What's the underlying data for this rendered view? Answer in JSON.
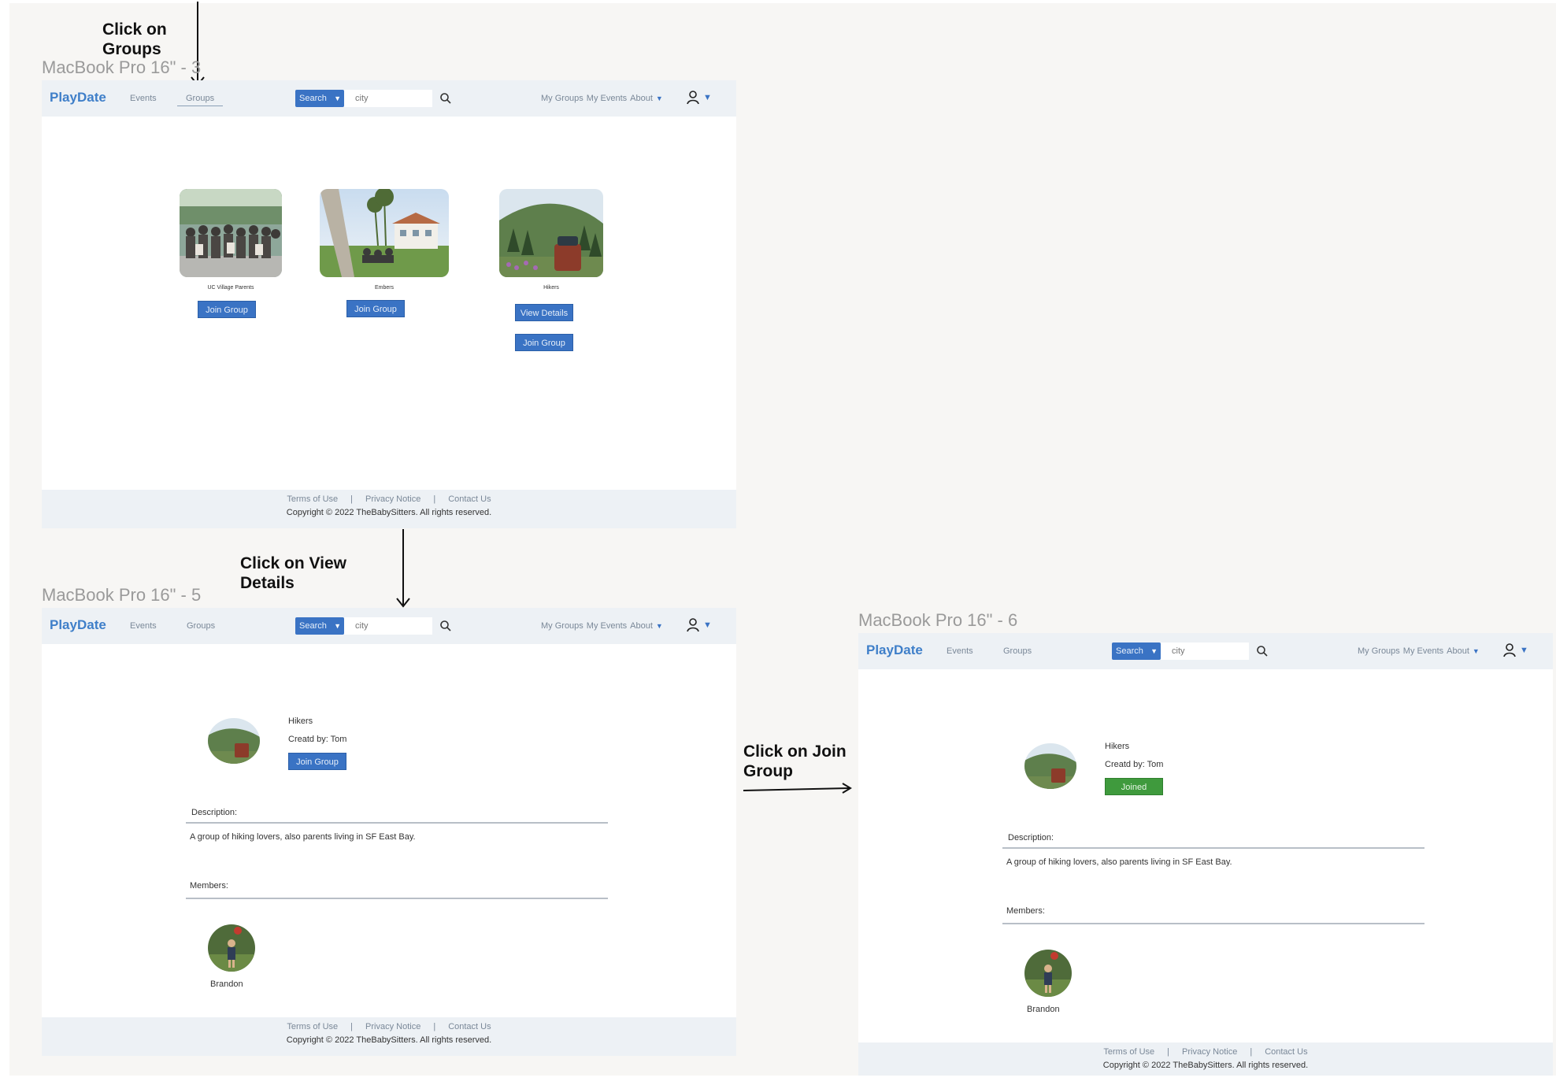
{
  "annotations": {
    "click_groups": [
      "Click on",
      "Groups"
    ],
    "click_view_details": [
      "Click on  View",
      "Details"
    ],
    "click_join_group": [
      "Click on Join",
      "Group"
    ]
  },
  "frames": {
    "f3": {
      "label": "MacBook Pro 16\" - 3"
    },
    "f5": {
      "label": "MacBook Pro 16\" - 5"
    },
    "f6": {
      "label": "MacBook Pro 16\" - 6"
    }
  },
  "nav": {
    "brand": "PlayDate",
    "events": "Events",
    "groups": "Groups",
    "search_button": "Search",
    "search_placeholder": "city",
    "my_groups": "My Groups",
    "my_events": "My Events",
    "about": "About"
  },
  "footer": {
    "terms": "Terms of Use",
    "privacy": "Privacy Notice",
    "contact": "Contact Us",
    "separator": "|",
    "copyright": "Copyright © 2022 TheBabySitters. All rights reserved."
  },
  "groups_page": {
    "cards": [
      {
        "name": "UC Village Parents",
        "join_label": "Join Group"
      },
      {
        "name": "Embers",
        "join_label": "Join Group"
      },
      {
        "name": "Hikers",
        "view_label": "View Details",
        "join_label": "Join Group"
      }
    ]
  },
  "group_detail": {
    "name": "Hikers",
    "created_by": "Creatd by: Tom",
    "join_label": "Join Group",
    "joined_label": "Joined",
    "description_heading": "Description:",
    "description": "A group of hiking lovers, also parents living in SF East Bay.",
    "members_heading": "Members:",
    "members": [
      {
        "name": "Brandon"
      }
    ]
  },
  "colors": {
    "brand": "#3f7fc9",
    "button": "#3a73c4",
    "joined": "#3f9a3d",
    "nav_bg": "#edf1f5"
  }
}
